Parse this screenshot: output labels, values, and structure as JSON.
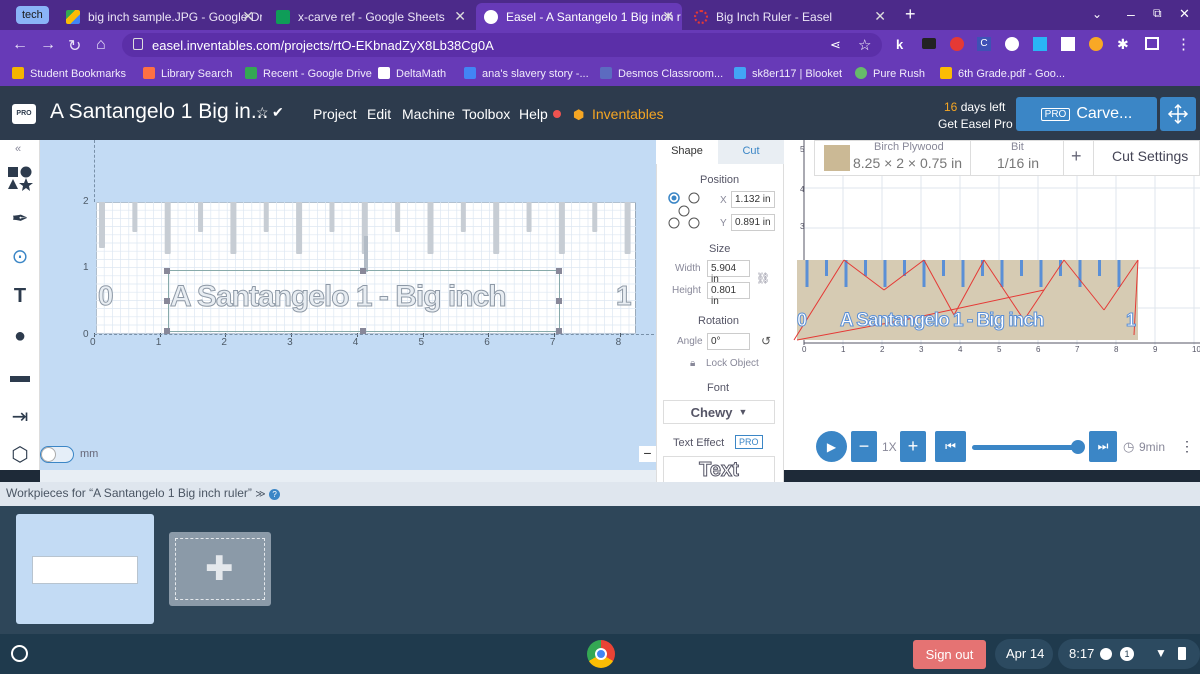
{
  "browser": {
    "group_chip": "tech",
    "tabs": [
      {
        "label": "big inch sample.JPG - Google Dr",
        "favicon_color": "#34a853"
      },
      {
        "label": "x-carve ref - Google Sheets",
        "favicon_color": "#0f9d58"
      },
      {
        "label": "Easel - A Santangelo 1 Big inch r",
        "favicon_color": "#f1f1f1",
        "active": true
      },
      {
        "label": "Big Inch Ruler - Easel",
        "favicon_color": "#e53935"
      }
    ],
    "new_tab": "+",
    "url": "easel.inventables.com/projects/rtO-EKbnadZyX8Lb38Cg0A",
    "bookmarks": [
      {
        "label": "Student Bookmarks",
        "color": "#f4b400"
      },
      {
        "label": "Library Search",
        "color": "#ff7043"
      },
      {
        "label": "Recent - Google Drive",
        "color": "#34a853"
      },
      {
        "label": "DeltaMath",
        "color": "#ffffff"
      },
      {
        "label": "ana's slavery story -...",
        "color": "#4285f4"
      },
      {
        "label": "Desmos Classroom...",
        "color": "#5c6bc0"
      },
      {
        "label": "sk8er117 | Blooket",
        "color": "#42a5f5"
      },
      {
        "label": "Pure Rush",
        "color": "#66bb6a"
      },
      {
        "label": "6th Grade.pdf - Goo...",
        "color": "#fbbc04"
      }
    ]
  },
  "easel": {
    "logo": "PRO",
    "project_title": "A Santangelo 1 Big in...",
    "menus": [
      "Project",
      "Edit",
      "Machine",
      "Toolbox",
      "Help"
    ],
    "inventables": "Inventables",
    "days_number": "16",
    "days_suffix": " days left",
    "get_pro": "Get Easel Pro",
    "carve_badge": "PRO",
    "carve_label": "Carve..."
  },
  "canvas": {
    "ruler_text": "A Santangelo 1 - Big inch",
    "zero_label": "0",
    "one_label": "1",
    "x_ticks": [
      "0",
      "1",
      "2",
      "3",
      "4",
      "5",
      "6",
      "7",
      "8"
    ],
    "y_ticks": [
      "0",
      "1",
      "2"
    ],
    "mm_label": "mm"
  },
  "shape_panel": {
    "tab_shape": "Shape",
    "tab_cut": "Cut",
    "position_label": "Position",
    "x_label": "X",
    "x_value": "1.132 in",
    "y_label": "Y",
    "y_value": "0.891 in",
    "size_label": "Size",
    "width_label": "Width",
    "width_value": "5.904 in",
    "height_label": "Height",
    "height_value": "0.801 in",
    "rotation_label": "Rotation",
    "angle_label": "Angle",
    "angle_value": "0°",
    "lock_label": "Lock Object",
    "font_label": "Font",
    "font_value": "Chewy",
    "text_effect_label": "Text Effect",
    "text_effect_badge": "PRO",
    "text_button": "Text"
  },
  "preview": {
    "material_label": "Birch Plywood",
    "material_dims": "8.25 × 2 × 0.75 in",
    "bit_label": "Bit",
    "bit_value": "1/16 in",
    "plus": "+",
    "cut_settings": "Cut Settings",
    "ruler_text": "A Santangelo 1 - Big inch",
    "zero_label": "0",
    "one_label": "1",
    "x_ticks": [
      "0",
      "1",
      "2",
      "3",
      "4",
      "5",
      "6",
      "7",
      "8",
      "9",
      "10"
    ],
    "y_ticks": [
      "5",
      "4",
      "3"
    ],
    "speed": "1X",
    "time": "9min"
  },
  "workpieces": {
    "title": "Workpieces for “A Santangelo 1 Big inch ruler”",
    "caret": "≫"
  },
  "taskbar": {
    "sign_out": "Sign out",
    "date": "Apr 14",
    "time": "8:17",
    "notif": "1"
  }
}
